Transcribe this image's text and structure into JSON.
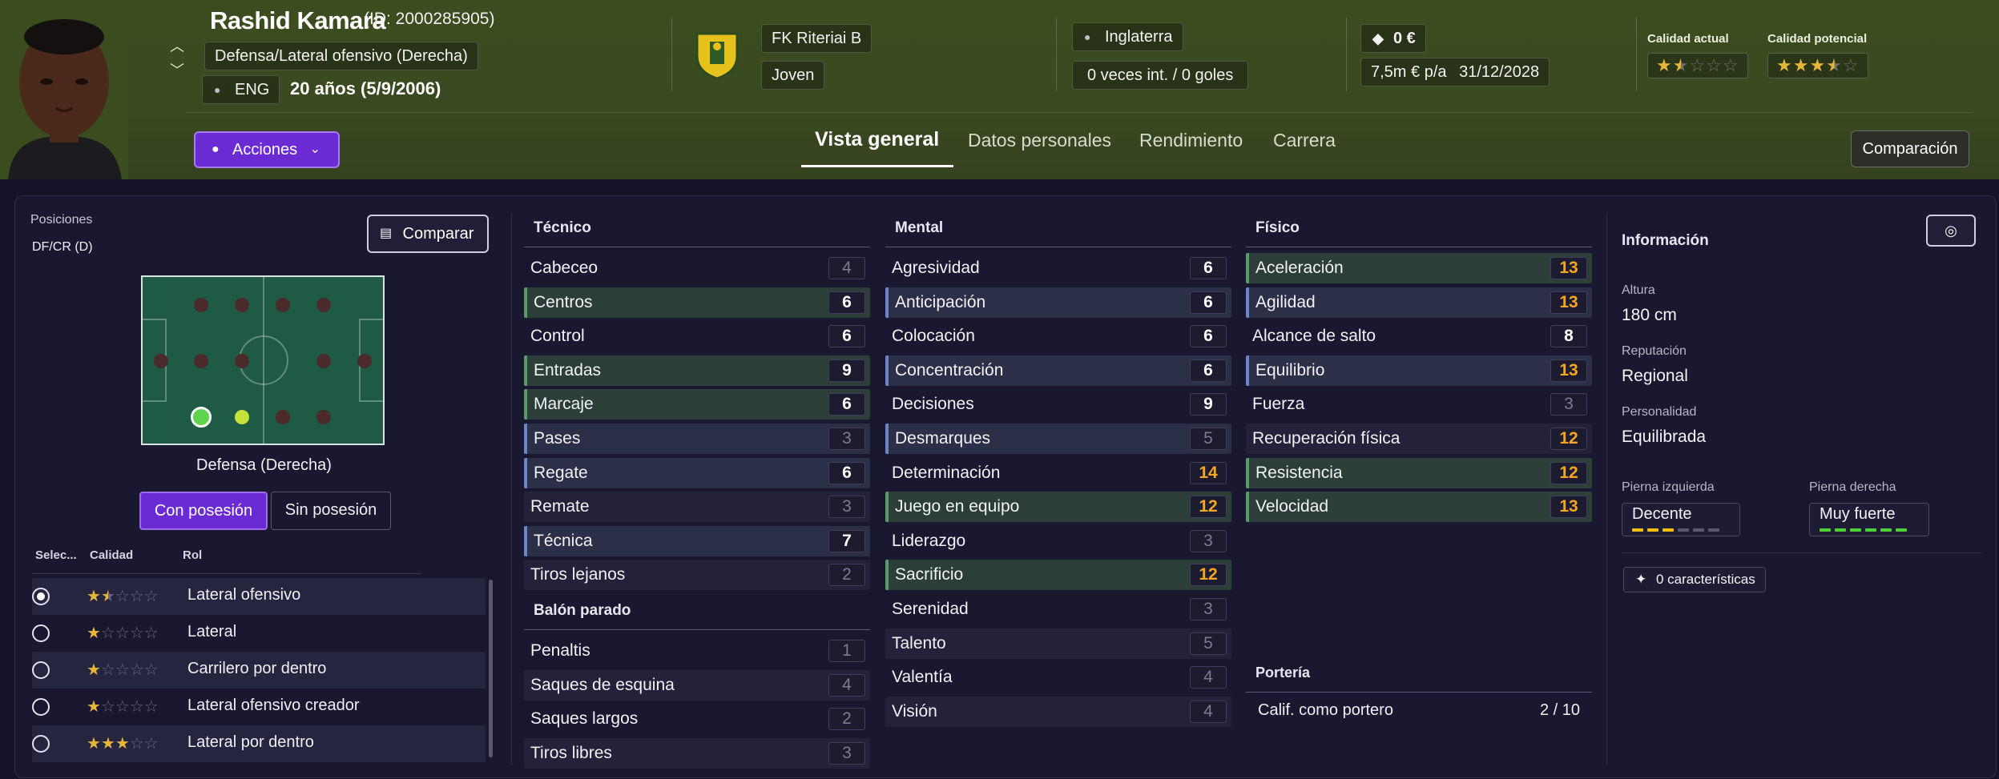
{
  "player": {
    "name": "Rashid Kamara",
    "id_text": "(ID: 2000285905)",
    "position": "Defensa/Lateral ofensivo (Derecha)",
    "nationality": "ENG",
    "age": "20 años (5/9/2006)"
  },
  "club": {
    "name": "FK Riteriai B",
    "squad": "Joven"
  },
  "nation": {
    "name": "Inglaterra",
    "caps": "0 veces int. / 0 goles"
  },
  "contract": {
    "value": "0 €",
    "wage": "7,5m € p/a",
    "expires": "31/12/2028"
  },
  "quality": {
    "current_label": "Calidad actual",
    "current_stars": 1.5,
    "potential_label": "Calidad potencial",
    "potential_stars": 3.5
  },
  "actions_label": "Acciones",
  "tabs": [
    "Vista general",
    "Datos personales",
    "Rendimiento",
    "Carrera"
  ],
  "compare_top": "Comparación",
  "positions": {
    "title": "Posiciones",
    "value": "DF/CR (D)",
    "compare_btn": "Comparar",
    "pitch_caption": "Defensa (Derecha)",
    "toggle": [
      "Con posesión",
      "Sin posesión"
    ],
    "headers": [
      "Selec...",
      "Calidad",
      "Rol"
    ],
    "roles": [
      {
        "name": "Lateral ofensivo",
        "stars": 1.5,
        "selected": true
      },
      {
        "name": "Lateral",
        "stars": 1,
        "selected": false
      },
      {
        "name": "Carrilero por dentro",
        "stars": 1,
        "selected": false
      },
      {
        "name": "Lateral ofensivo creador",
        "stars": 1,
        "selected": false
      },
      {
        "name": "Lateral por dentro",
        "stars": 3,
        "selected": false
      }
    ]
  },
  "tecnico": {
    "title": "Técnico",
    "attrs": [
      {
        "name": "Cabeceo",
        "value": "4",
        "hl": "",
        "color": "dim"
      },
      {
        "name": "Centros",
        "value": "6",
        "hl": "green",
        "color": "white"
      },
      {
        "name": "Control",
        "value": "6",
        "hl": "",
        "color": "white"
      },
      {
        "name": "Entradas",
        "value": "9",
        "hl": "green",
        "color": "white"
      },
      {
        "name": "Marcaje",
        "value": "6",
        "hl": "green",
        "color": "white"
      },
      {
        "name": "Pases",
        "value": "3",
        "hl": "blue",
        "color": "dim"
      },
      {
        "name": "Regate",
        "value": "6",
        "hl": "blue",
        "color": "white"
      },
      {
        "name": "Remate",
        "value": "3",
        "hl": "",
        "color": "dim"
      },
      {
        "name": "Técnica",
        "value": "7",
        "hl": "blue",
        "color": "white"
      },
      {
        "name": "Tiros lejanos",
        "value": "2",
        "hl": "",
        "color": "dim"
      }
    ]
  },
  "balon_parado": {
    "title": "Balón parado",
    "attrs": [
      {
        "name": "Penaltis",
        "value": "1",
        "hl": "",
        "color": "dim"
      },
      {
        "name": "Saques de esquina",
        "value": "4",
        "hl": "",
        "color": "dim"
      },
      {
        "name": "Saques largos",
        "value": "2",
        "hl": "",
        "color": "dim"
      },
      {
        "name": "Tiros libres",
        "value": "3",
        "hl": "",
        "color": "dim"
      }
    ]
  },
  "mental": {
    "title": "Mental",
    "attrs": [
      {
        "name": "Agresividad",
        "value": "6",
        "hl": "",
        "color": "white"
      },
      {
        "name": "Anticipación",
        "value": "6",
        "hl": "blue",
        "color": "white"
      },
      {
        "name": "Colocación",
        "value": "6",
        "hl": "",
        "color": "white"
      },
      {
        "name": "Concentración",
        "value": "6",
        "hl": "blue",
        "color": "white"
      },
      {
        "name": "Decisiones",
        "value": "9",
        "hl": "",
        "color": "white"
      },
      {
        "name": "Desmarques",
        "value": "5",
        "hl": "blue",
        "color": "dim"
      },
      {
        "name": "Determinación",
        "value": "14",
        "hl": "",
        "color": "orange"
      },
      {
        "name": "Juego en equipo",
        "value": "12",
        "hl": "green",
        "color": "orange"
      },
      {
        "name": "Liderazgo",
        "value": "3",
        "hl": "",
        "color": "dim"
      },
      {
        "name": "Sacrificio",
        "value": "12",
        "hl": "green",
        "color": "orange"
      },
      {
        "name": "Serenidad",
        "value": "3",
        "hl": "",
        "color": "dim"
      },
      {
        "name": "Talento",
        "value": "5",
        "hl": "",
        "color": "dim"
      },
      {
        "name": "Valentía",
        "value": "4",
        "hl": "",
        "color": "dim"
      },
      {
        "name": "Visión",
        "value": "4",
        "hl": "",
        "color": "dim"
      }
    ]
  },
  "fisico": {
    "title": "Físico",
    "attrs": [
      {
        "name": "Aceleración",
        "value": "13",
        "hl": "green",
        "color": "orange"
      },
      {
        "name": "Agilidad",
        "value": "13",
        "hl": "blue",
        "color": "orange"
      },
      {
        "name": "Alcance de salto",
        "value": "8",
        "hl": "",
        "color": "white"
      },
      {
        "name": "Equilibrio",
        "value": "13",
        "hl": "blue",
        "color": "orange"
      },
      {
        "name": "Fuerza",
        "value": "3",
        "hl": "",
        "color": "dim"
      },
      {
        "name": "Recuperación física",
        "value": "12",
        "hl": "",
        "color": "orange"
      },
      {
        "name": "Resistencia",
        "value": "12",
        "hl": "green",
        "color": "orange"
      },
      {
        "name": "Velocidad",
        "value": "13",
        "hl": "green",
        "color": "orange"
      }
    ]
  },
  "porteria": {
    "title": "Portería",
    "label": "Calif. como portero",
    "value": "2 / 10"
  },
  "info": {
    "title": "Información",
    "height_label": "Altura",
    "height": "180 cm",
    "rep_label": "Reputación",
    "rep": "Regional",
    "pers_label": "Personalidad",
    "pers": "Equilibrada",
    "left_foot_label": "Pierna izquierda",
    "left_foot": "Decente",
    "left_foot_level": 3,
    "right_foot_label": "Pierna derecha",
    "right_foot": "Muy fuerte",
    "right_foot_level": 6,
    "traits": "0 características"
  },
  "colors": {
    "accent": "#6b2bd4",
    "orange": "#f5a623",
    "green_hl": "#5a9a68",
    "blue_hl": "#6c84c8",
    "foot_yellow": "#f0c20e",
    "foot_green": "#4cd137"
  }
}
